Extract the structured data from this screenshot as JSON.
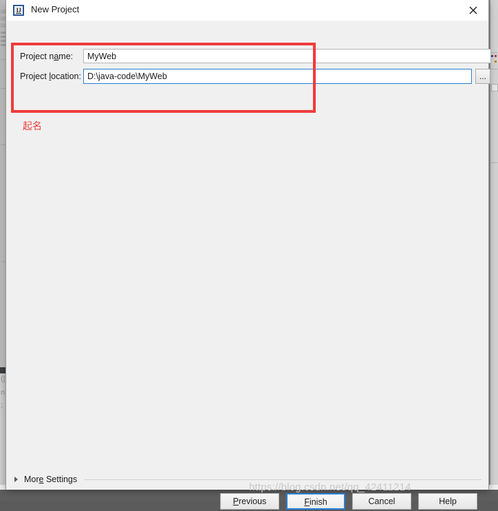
{
  "window": {
    "title": "New Project",
    "icon": "intellij-idea-icon",
    "icon_text": "IJ",
    "close_icon": "close-icon"
  },
  "form": {
    "project_name": {
      "label_before": "Project n",
      "label_mnemonic": "a",
      "label_after": "me:",
      "label_full": "Project name:",
      "value": "MyWeb",
      "placeholder": ""
    },
    "project_location": {
      "label_before": "Project ",
      "label_mnemonic": "l",
      "label_after": "ocation:",
      "label_full": "Project location:",
      "value": "D:\\java-code\\MyWeb",
      "placeholder": ""
    },
    "browse_button": {
      "label": "...",
      "name": "browse-ellipsis-button"
    }
  },
  "annotation": {
    "note_text": "起名",
    "box_color": "#f03b3b",
    "note_color": "#ef3f3f"
  },
  "more_settings": {
    "label_before": "Mor",
    "label_mnemonic": "e",
    "label_after": " Settings",
    "label_full": "More Settings",
    "expander_icon": "triangle-right-icon",
    "expanded": false
  },
  "buttons": [
    {
      "name": "previous-button",
      "label": "Previous",
      "mnemonic": "P",
      "default": false
    },
    {
      "name": "finish-button",
      "label": "Finish",
      "mnemonic": "F",
      "default": true
    },
    {
      "name": "cancel-button",
      "label": "Cancel",
      "mnemonic": "",
      "default": false
    },
    {
      "name": "help-button",
      "label": "Help",
      "mnemonic": "",
      "default": false
    }
  ],
  "button_labels": {
    "previous_before": "",
    "previous_mn": "P",
    "previous_after": "revious",
    "finish_before": "",
    "finish_mn": "F",
    "finish_after": "inish",
    "cancel": "Cancel",
    "help": "Help"
  },
  "watermark": {
    "text": "https://blog.csdn.net/qq_42411214"
  },
  "background": {
    "bottom_bar_text": ""
  },
  "colors": {
    "dialog_bg": "#f0f0f0",
    "titlebar_bg": "#ffffff",
    "focus_blue": "#2a7fd4",
    "desktop": "#5e5e5e",
    "text": "#1b1b1b"
  }
}
